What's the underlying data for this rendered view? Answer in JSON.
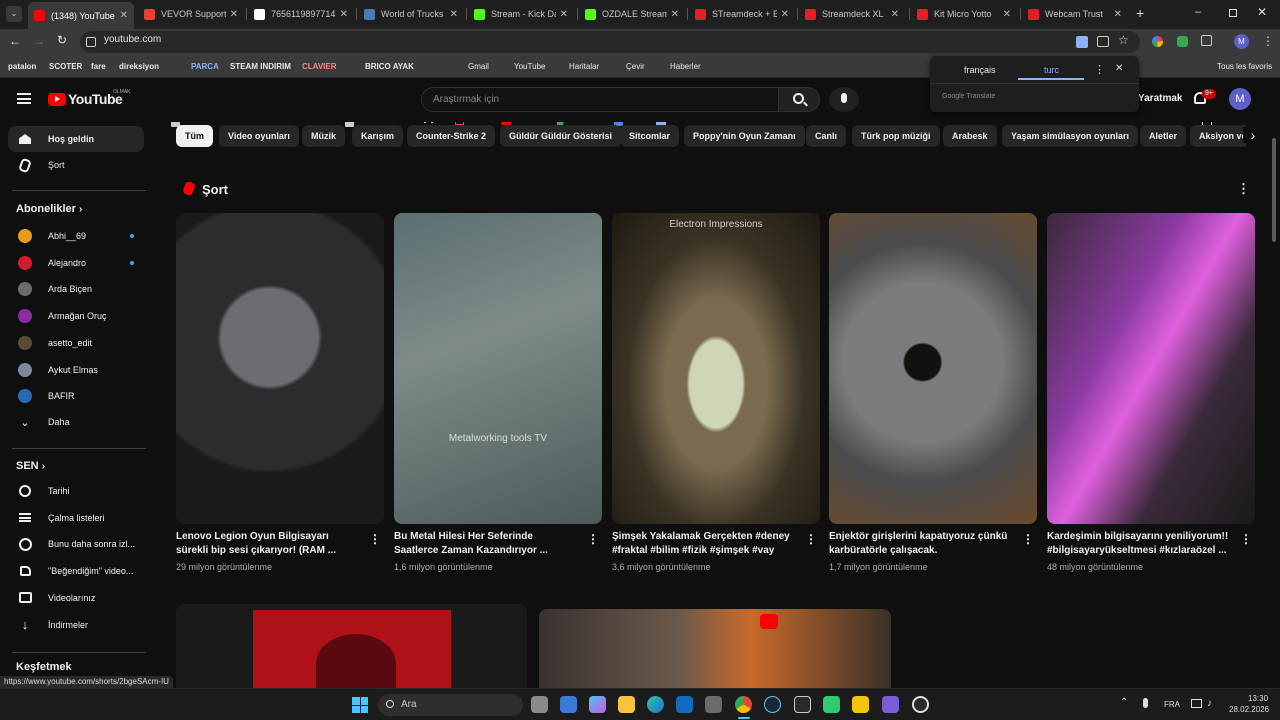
{
  "browser": {
    "tabs": [
      {
        "title": "(1348) YouTube",
        "fav": "#ff0000",
        "active": true
      },
      {
        "title": "VEVOR Support o",
        "fav": "#e8412c"
      },
      {
        "title": "76561198977142",
        "fav": "#ffffff"
      },
      {
        "title": "World of Trucks",
        "fav": "#4a7bb7"
      },
      {
        "title": "Stream - Kick Das",
        "fav": "#53fc18"
      },
      {
        "title": "OZDALE Stream -",
        "fav": "#53fc18"
      },
      {
        "title": "STreamdeck + El",
        "fav": "#e31e24"
      },
      {
        "title": "Streamdeck XL",
        "fav": "#e31e24"
      },
      {
        "title": "Kit Micro Yotto",
        "fav": "#e31e24"
      },
      {
        "title": "Webcam Trust",
        "fav": "#e31e24"
      }
    ],
    "new_tab": "+",
    "url": "youtube.com",
    "status_url": "https://www.youtube.com/shorts/2bgeSAcm-IU"
  },
  "bookmarks": {
    "items": [
      "patalon",
      "SCOTER",
      "fare",
      "direksiyon",
      "PARCA",
      "STEAM INDIRIM",
      "CLAVIER",
      "BRICO AYAK",
      "Gmail",
      "YouTube",
      "Haritalar",
      "Çevir",
      "Haberler"
    ],
    "all_bookmarks": "Tous les favoris"
  },
  "translate": {
    "lang_from": "français",
    "lang_to": "turc",
    "provider": "Google Translate"
  },
  "youtube": {
    "logo_text": "YouTube",
    "region": "OLMAK",
    "search_placeholder": "Araştırmak için",
    "create_label": "Yaratmak",
    "notif_count": "9+",
    "user_initial": "M"
  },
  "sidebar": {
    "top": [
      {
        "label": "Hoş geldin",
        "icon": "home-icon"
      },
      {
        "label": "Şort",
        "icon": "shorts-icon"
      }
    ],
    "subs_heading": "Abonelikler",
    "subs": [
      {
        "label": "Abhi__69",
        "color": "#e89a1a",
        "live": true
      },
      {
        "label": "Alejandro",
        "color": "#d21c2c",
        "live": true
      },
      {
        "label": "Arda Biçen",
        "color": "#6b6b6b"
      },
      {
        "label": "Armağan Oruç",
        "color": "#8c2b9e"
      },
      {
        "label": "asetto_edit",
        "color": "#5a4a3a"
      },
      {
        "label": "Aykut Elmas",
        "color": "#7a8a9a"
      },
      {
        "label": "BAFIR",
        "color": "#2a6ab0"
      }
    ],
    "more_label": "Daha",
    "you_heading": "SEN",
    "you": [
      {
        "label": "Tarihi",
        "icon": "history-icon"
      },
      {
        "label": "Çalma listeleri",
        "icon": "playlist-icon"
      },
      {
        "label": "Bunu daha sonra izl...",
        "icon": "watch-later-icon"
      },
      {
        "label": "\"Beğendiğim\" video...",
        "icon": "like-icon"
      },
      {
        "label": "Videolarınız",
        "icon": "your-videos-icon"
      },
      {
        "label": "İndirmeler",
        "icon": "download-icon"
      }
    ],
    "explore_heading": "Keşfetmek"
  },
  "chips": [
    "Tüm",
    "Video oyunları",
    "Müzik",
    "Karışım",
    "Counter-Strike 2",
    "Güldür Güldür Gösterisi",
    "Sitcomlar",
    "Poppy'nin Oyun Zamanı",
    "Canlı",
    "Türk pop müziği",
    "Arabesk",
    "Yaşam simülasyon oyunları",
    "Aletler",
    "Aksiyon ve"
  ],
  "shorts": {
    "heading": "Şort",
    "items": [
      {
        "title": "Lenovo Legion Oyun Bilgisayarı sürekli bip sesi çıkarıyor! (RAM ...",
        "views": "29 milyon görüntülenme",
        "overlay": ""
      },
      {
        "title": "Bu Metal Hilesi Her Seferinde Saatlerce Zaman Kazandırıyor ...",
        "views": "1,6 milyon görüntülenme",
        "overlay": "Metalworking tools TV"
      },
      {
        "title": "Şimşek Yakalamak Gerçekten #deney #fraktal #bilim #fizik #şimşek #vay",
        "views": "3,6 milyon görüntülenme",
        "overlay": "Electron Impressions"
      },
      {
        "title": "Enjektör girişlerini kapatıyoruz çünkü karbüratörle çalışacak.",
        "views": "1,7 milyon görüntülenme",
        "overlay": ""
      },
      {
        "title": "Kardeşimin bilgisayarını yeniliyorum!! #bilgisayaryükseltmesi #kızlaraözel ...",
        "views": "48 milyon görüntülenme",
        "overlay": ""
      }
    ]
  },
  "taskbar": {
    "search_label": "Ara",
    "lang": "FRA",
    "time": "13:30",
    "date": "28.02.2026"
  }
}
